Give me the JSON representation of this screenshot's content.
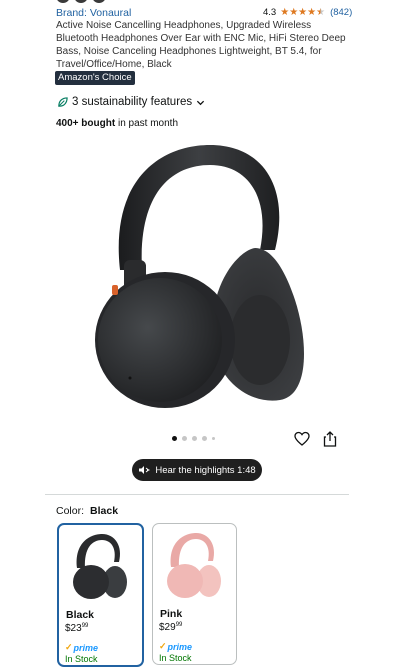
{
  "product": {
    "brand": "Brand: Vonaural",
    "rating_value": "4.3",
    "rating_stars": 4.3,
    "rating_count": "(842)",
    "title": "Active Noise Cancelling Headphones, Upgraded Wireless Bluetooth Headphones Over Ear with ENC Mic, HiFi Stereo Deep Bass, Noise Canceling Headphones Lightweight, BT 5.4, for Travel/Office/Home, Black",
    "badge": "Amazon's Choice",
    "sustainability": "3 sustainability features",
    "bought_bold": "400+ bought",
    "bought_rest": " in past month"
  },
  "gallery": {
    "image_icon": "headphones-black",
    "dots_total": 5,
    "dots_active": 0,
    "highlights_label": "Hear the highlights 1:48"
  },
  "color": {
    "label": "Color:",
    "selected": "Black",
    "options": [
      {
        "name": "Black",
        "price_whole": "$23",
        "price_frac": "99",
        "prime": "prime",
        "stock": "In Stock",
        "accent": "#3a3d40"
      },
      {
        "name": "Pink",
        "price_whole": "$29",
        "price_frac": "99",
        "prime": "prime",
        "stock": "In Stock",
        "accent": "#f0b8b5"
      }
    ]
  },
  "colors": {
    "link": "#2162a1",
    "star": "#de7921",
    "badge_bg": "#232f3e",
    "prime": "#1a98ff",
    "selected_border": "#2162a1"
  }
}
